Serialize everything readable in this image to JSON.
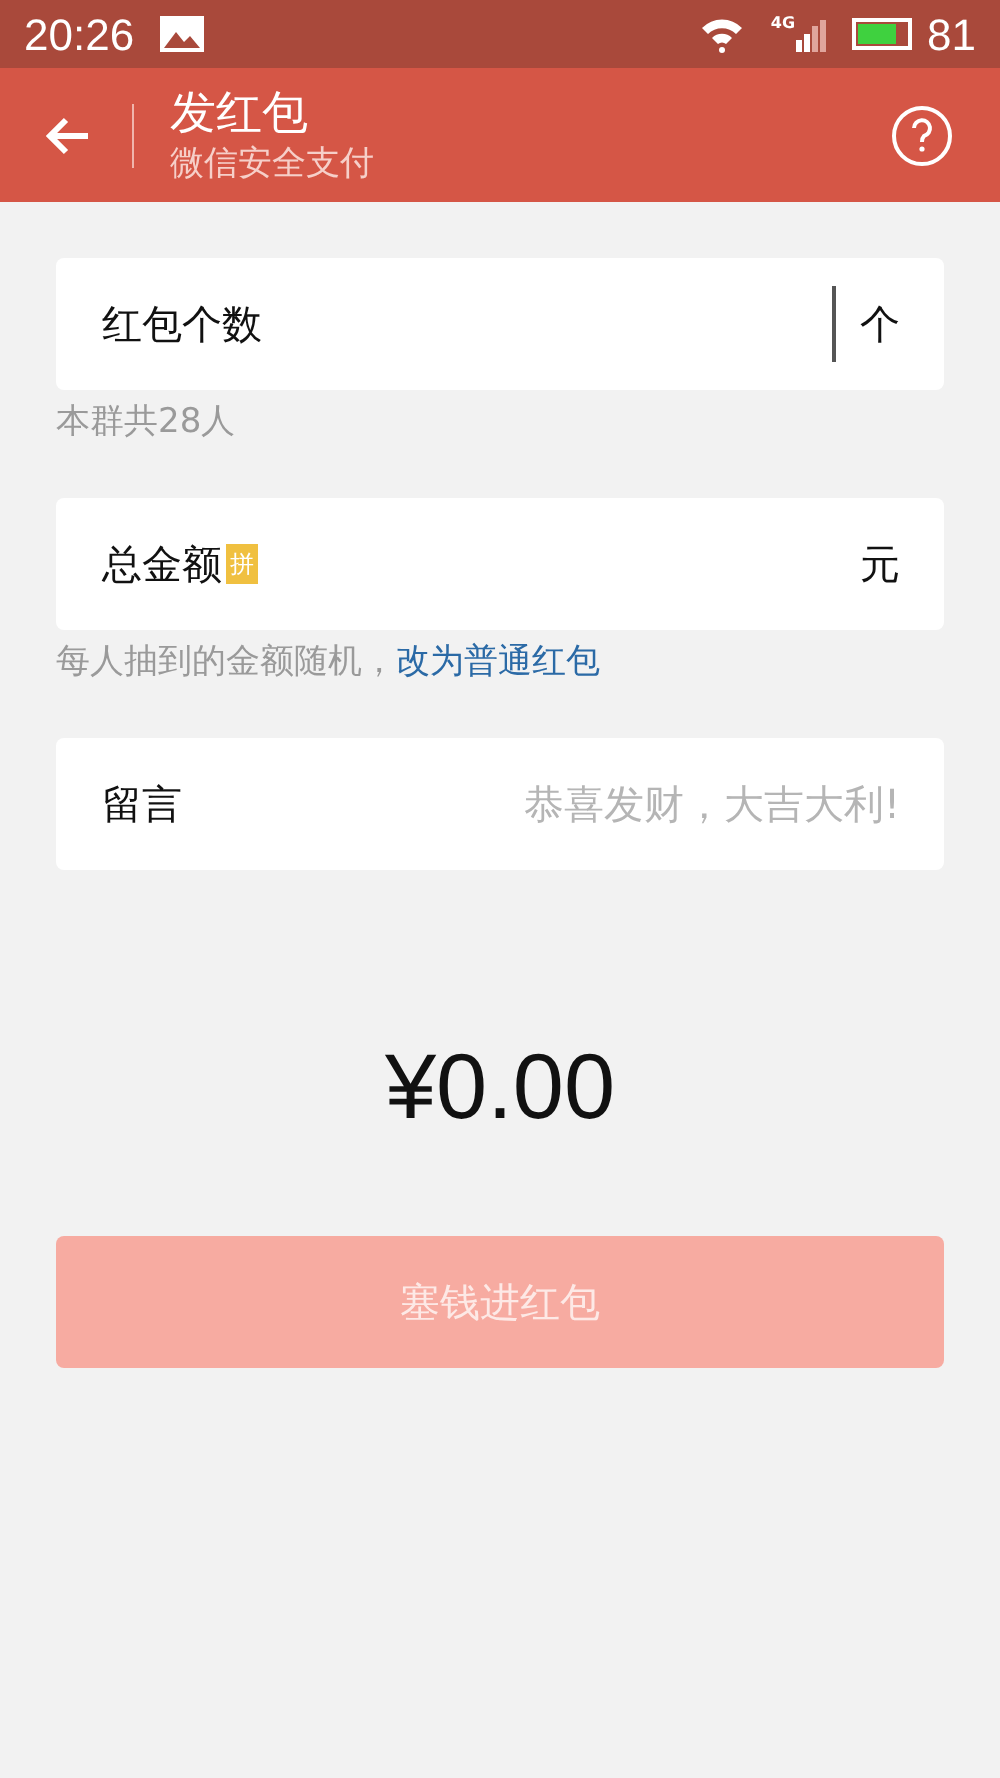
{
  "status_bar": {
    "time": "20:26",
    "network": "4G",
    "battery_text": "81"
  },
  "header": {
    "title": "发红包",
    "subtitle": "微信安全支付"
  },
  "fields": [
    {
      "label": "红包个数",
      "unit": "个",
      "focused": true,
      "hint": "本群共28人"
    },
    {
      "label": "总金额",
      "badge": "拼",
      "unit": "元",
      "focused": false,
      "hint": "每人抽到的金额随机，",
      "hint_link": "改为普通红包"
    },
    {
      "label": "留言",
      "placeholder": "恭喜发财，大吉大利!",
      "focused": false
    }
  ],
  "amount": "¥0.00",
  "submit": {
    "label": "塞钱进红包",
    "disabled": true
  }
}
